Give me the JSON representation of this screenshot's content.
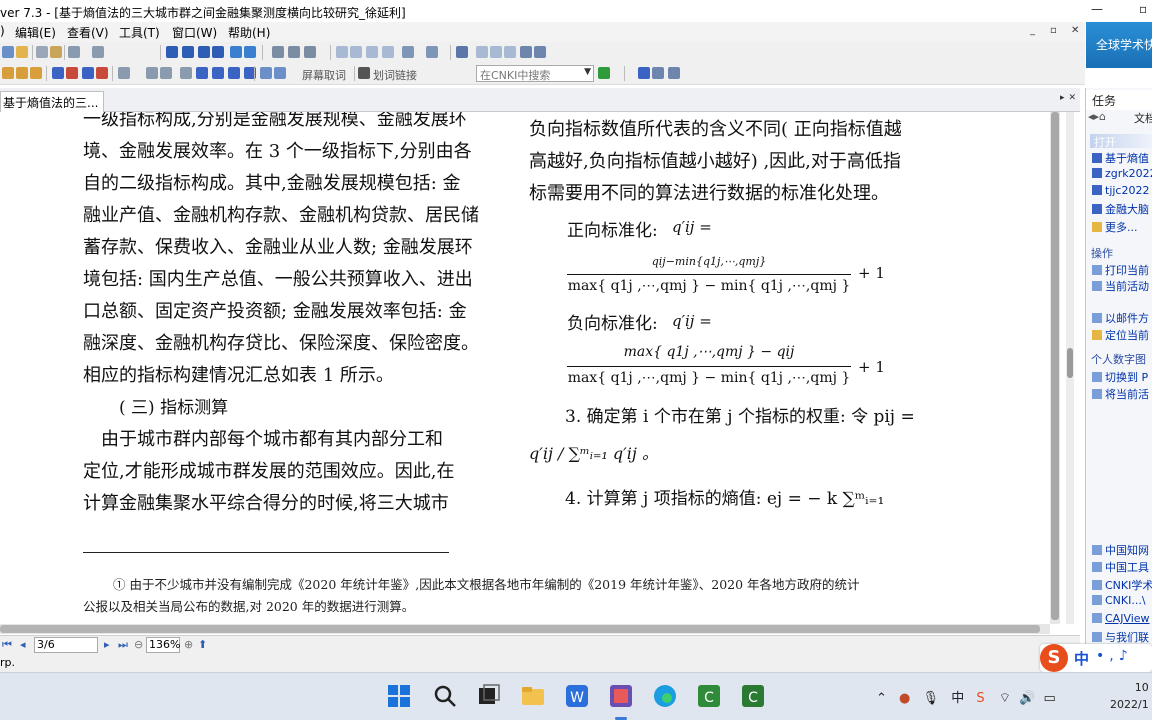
{
  "window": {
    "title": "ver 7.3 - [基于熵值法的三大城市群之间金融集聚测度横向比较研究_徐延利]"
  },
  "menubar": {
    "items": [
      "编辑(E)",
      "查看(V)",
      "工具(T)",
      "窗口(W)",
      "帮助(H)"
    ],
    "left_stub": ")"
  },
  "toolbar": {
    "screenshot_label": "屏幕取词",
    "lookup_label": "划词链接",
    "search_placeholder": "在CNKI中搜索"
  },
  "document_tab": {
    "label": "基于熵值法的三..."
  },
  "document": {
    "left_column": [
      "一级指标构成,分别是金融发展规模、金融发展环",
      "境、金融发展效率。在 3 个一级指标下,分别由各",
      "自的二级指标构成。其中,金融发展规模包括: 金",
      "融业产值、金融机构存款、金融机构贷款、居民储",
      "蓄存款、保费收入、金融业从业人数; 金融发展环",
      "境包括: 国内生产总值、一般公共预算收入、进出",
      "口总额、固定资产投资额; 金融发展效率包括: 金",
      "融深度、金融机构存贷比、保险深度、保险密度。",
      "相应的指标构建情况汇总如表 1 所示。"
    ],
    "heading": "( 三) 指标测算",
    "left_column_2": [
      "　由于城市群内部每个城市都有其内部分工和",
      "定位,才能形成城市群发展的范围效应。因此,在",
      "计算金融集聚水平综合得分的时候,将三大城市"
    ],
    "right_column": [
      "负向指标数值所代表的含义不同( 正向指标值越",
      "高越好,负向指标值越小越好) ,因此,对于高低指",
      "标需要用不同的算法进行数据的标准化处理。"
    ],
    "pos_norm_label": "正向标准化:",
    "neg_norm_label": "负向标准化:",
    "q_ij_eq": "q′ij  =",
    "pos_numerator": "qij−min{q1j,⋯,qmj}",
    "pos_denominator": "max{ q1j ,⋯,qmj }  − min{ q1j ,⋯,qmj }",
    "neg_numerator": "max{ q1j ,⋯,qmj }  − qij",
    "neg_denominator": "max{ q1j ,⋯,qmj }  − min{ q1j ,⋯,qmj }",
    "plus_one": "+ 1",
    "step3": "3.  确定第 i 个市在第 j 个指标的权重: 令 pij  =",
    "step3_b": "q′ij / ∑ᵐᵢ₌₁ q′ij 。",
    "step4": "4.  计算第 j 项指标的熵值:  ej  = − k ∑ᵐᵢ₌₁",
    "footnote_1": "①  由于不少城市并没有编制完成《2020 年统计年鉴》,因此本文根据各地市年编制的《2019 年统计年鉴》、2020 年各地方政府的统计",
    "footnote_2": "公报以及相关当局公布的数据,对 2020 年的数据进行测算。"
  },
  "pagebar": {
    "page": "3/6",
    "zoom": "136%"
  },
  "statusbar": {
    "text": "rp."
  },
  "right_pane": {
    "banner": "全球学术快",
    "header": "任务",
    "tab_label": "文档",
    "open_header": "打开",
    "open_items": [
      "基于熵值",
      "zgrk2022",
      "tjjc2022",
      "金融大脑",
      "更多..."
    ],
    "ops_header": "操作",
    "ops_items": [
      "打印当前",
      "当前活动"
    ],
    "ops_items_2": [
      "以邮件方",
      "定位当前"
    ],
    "personal_header": "个人数字图",
    "personal_items": [
      "切换到 P",
      "将当前活"
    ],
    "links": [
      "中国知网",
      "中国工具",
      "CNKI学术",
      "CNKI...\\",
      "CAJView",
      "与我们联"
    ]
  },
  "taskbar": {
    "tray_text": "中",
    "clock_time": "10",
    "clock_date": "2022/1"
  },
  "colors": {
    "accent": "#2a8fd6",
    "link": "#0033aa",
    "ime": "#e84d1c"
  }
}
